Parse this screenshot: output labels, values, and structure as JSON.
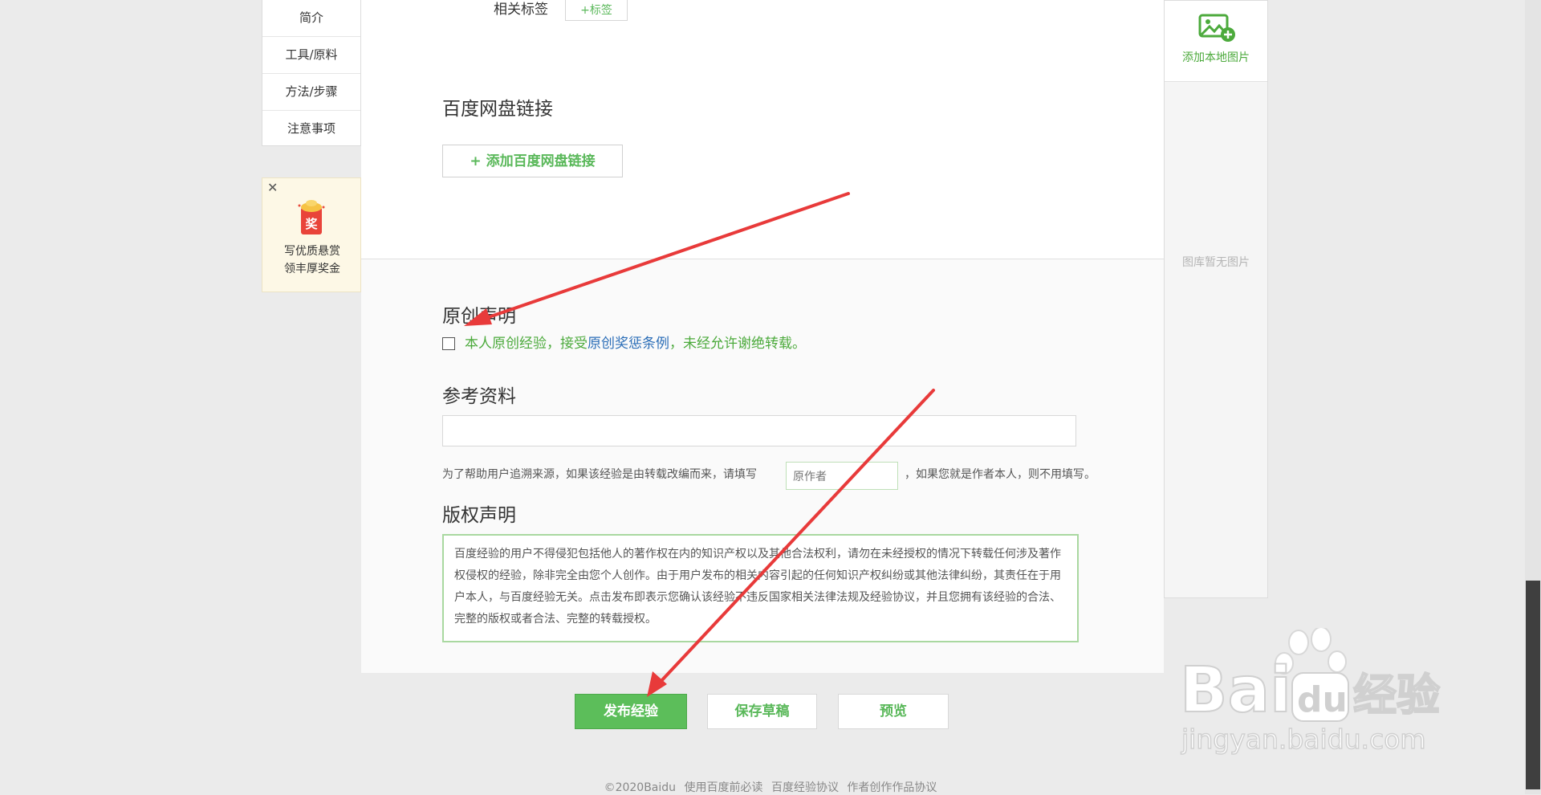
{
  "left_nav": {
    "items": [
      "简介",
      "工具/原料",
      "方法/步骤",
      "注意事项"
    ]
  },
  "promo": {
    "close_glyph": "✕",
    "badge": "奖",
    "line1": "写优质悬赏",
    "line2": "领丰厚奖金"
  },
  "tags": {
    "label": "相关标签",
    "add_button": "+标签"
  },
  "baidu_pan": {
    "title": "百度网盘链接",
    "add_button": "+ 添加百度网盘链接"
  },
  "original": {
    "title": "原创声明",
    "text_before": "本人原创经验，接受",
    "link": "原创奖惩条例",
    "text_after": "，未经允许谢绝转载。"
  },
  "reference": {
    "title": "参考资料",
    "input_value": "",
    "hint_before": "为了帮助用户追溯来源，如果该经验是由转载改编而来，请填写",
    "author_placeholder": "原作者",
    "hint_after": "，如果您就是作者本人，则不用填写。"
  },
  "copyright": {
    "title": "版权声明",
    "body": "百度经验的用户不得侵犯包括他人的著作权在内的知识产权以及其他合法权利，请勿在未经授权的情况下转载任何涉及著作权侵权的经验，除非完全由您个人创作。由于用户发布的相关内容引起的任何知识产权纠纷或其他法律纠纷，其责任在于用户本人，与百度经验无关。点击发布即表示您确认该经验不违反国家相关法律法规及经验协议，并且您拥有该经验的合法、完整的版权或者合法、完整的转载授权。"
  },
  "buttons": {
    "publish": "发布经验",
    "save_draft": "保存草稿",
    "preview": "预览"
  },
  "right_panel": {
    "add_local_image": "添加本地图片",
    "empty_text": "图库暂无图片"
  },
  "footer": {
    "items": [
      "©2020Baidu",
      "使用百度前必读",
      "百度经验协议",
      "作者创作作品协议"
    ]
  },
  "watermark": {
    "brand": "Bai",
    "du": "du",
    "cn": "经验",
    "url": "jingyan.baidu.com"
  },
  "colors": {
    "green": "#5cbe5a",
    "link_blue": "#2d6fb8",
    "arrow_red": "#e83a3a"
  }
}
